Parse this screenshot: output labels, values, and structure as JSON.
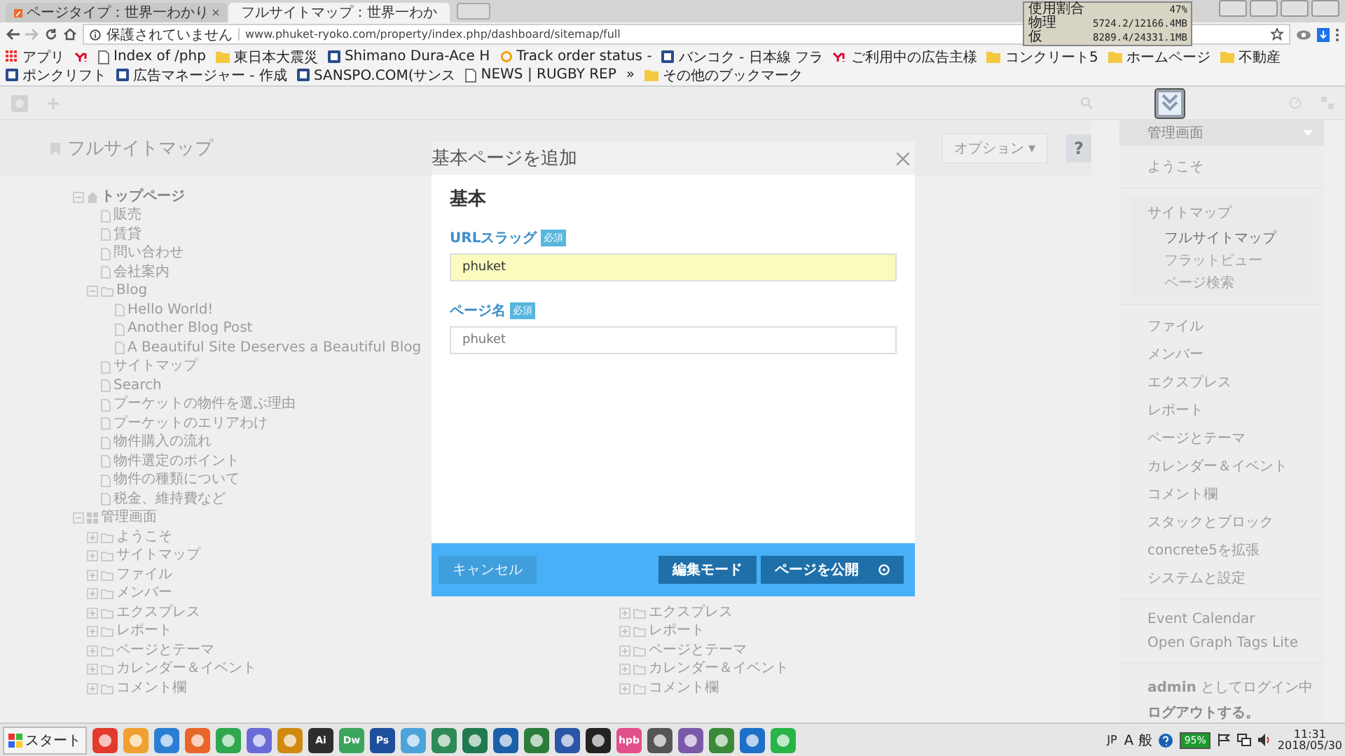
{
  "browser": {
    "tabs": [
      {
        "title": "ページタイプ：世界一わかり",
        "selected": false
      },
      {
        "title": "フルサイトマップ：世界一わか",
        "selected": true
      }
    ],
    "security": "保護されていません",
    "url": "www.phuket-ryoko.com/property/index.php/dashboard/sitemap/full",
    "bookmarks": [
      {
        "kind": "apps",
        "label": "アプリ"
      },
      {
        "kind": "yahoo"
      },
      {
        "kind": "page",
        "label": "Index of /php"
      },
      {
        "kind": "folder",
        "label": "東日本大震災"
      },
      {
        "kind": "site",
        "label": "Shimano Dura-Ace H"
      },
      {
        "kind": "bulb",
        "label": "Track order status -"
      },
      {
        "kind": "site",
        "label": "バンコク - 日本線 フラ"
      },
      {
        "kind": "yahoo",
        "label": "ご利用中の広告主様"
      },
      {
        "kind": "folder",
        "label": "コンクリート5"
      },
      {
        "kind": "folder",
        "label": "ホームページ"
      },
      {
        "kind": "folder",
        "label": "不動産"
      },
      {
        "kind": "site",
        "label": "ポンクリフト"
      },
      {
        "kind": "site",
        "label": "広告マネージャー - 作成"
      },
      {
        "kind": "site",
        "label": "SANSPO.COM(サンス"
      },
      {
        "kind": "page",
        "label": "NEWS | RUGBY REP"
      },
      {
        "kind": "more",
        "label": "»"
      },
      {
        "kind": "folder",
        "label": "その他のブックマーク"
      }
    ]
  },
  "memory_meter": [
    {
      "label": "使用割合",
      "value": "47%"
    },
    {
      "label": "物理",
      "value": "5724.2/12166.4MB"
    },
    {
      "label": "仮",
      "value": "8289.4/24331.1MB"
    }
  ],
  "page": {
    "title": "フルサイトマップ",
    "options_button": "オプション ▾",
    "help_button": "?"
  },
  "tree": [
    {
      "label": "トップページ",
      "kind": "home",
      "expanded": true,
      "children": [
        {
          "label": "販売",
          "kind": "page"
        },
        {
          "label": "賃貸",
          "kind": "page"
        },
        {
          "label": "問い合わせ",
          "kind": "page"
        },
        {
          "label": "会社案内",
          "kind": "page"
        },
        {
          "label": "Blog",
          "kind": "folder",
          "expanded": true,
          "children": [
            {
              "label": "Hello World!",
              "kind": "page"
            },
            {
              "label": "Another Blog Post",
              "kind": "page"
            },
            {
              "label": "A Beautiful Site Deserves a Beautiful Blog",
              "kind": "page"
            }
          ]
        },
        {
          "label": "サイトマップ",
          "kind": "page"
        },
        {
          "label": "Search",
          "kind": "page"
        },
        {
          "label": "プーケットの物件を選ぶ理由",
          "kind": "page"
        },
        {
          "label": "プーケットのエリアわけ",
          "kind": "page"
        },
        {
          "label": "物件購入の流れ",
          "kind": "page"
        },
        {
          "label": "物件選定のポイント",
          "kind": "page"
        },
        {
          "label": "物件の種類について",
          "kind": "page"
        },
        {
          "label": "税金、維持費など",
          "kind": "page"
        }
      ]
    },
    {
      "label": "管理画面",
      "kind": "dashboard",
      "expanded": true,
      "children": [
        {
          "label": "ようこそ",
          "kind": "folder",
          "expanded": false
        },
        {
          "label": "サイトマップ",
          "kind": "folder",
          "expanded": false
        },
        {
          "label": "ファイル",
          "kind": "folder",
          "expanded": false
        },
        {
          "label": "メンバー",
          "kind": "folder",
          "expanded": false
        },
        {
          "label": "エクスプレス",
          "kind": "folder",
          "expanded": false
        },
        {
          "label": "レポート",
          "kind": "folder",
          "expanded": false
        },
        {
          "label": "ページとテーマ",
          "kind": "folder",
          "expanded": false
        },
        {
          "label": "カレンダー＆イベント",
          "kind": "folder",
          "expanded": false
        },
        {
          "label": "コメント欄",
          "kind": "folder",
          "expanded": false
        }
      ]
    }
  ],
  "tree_column_2": [
    {
      "label": "エクスプレス",
      "kind": "folder",
      "expanded": false
    },
    {
      "label": "レポート",
      "kind": "folder",
      "expanded": false
    },
    {
      "label": "ページとテーマ",
      "kind": "folder",
      "expanded": false
    },
    {
      "label": "カレンダー＆イベント",
      "kind": "folder",
      "expanded": false
    },
    {
      "label": "コメント欄",
      "kind": "folder",
      "expanded": false
    }
  ],
  "panel": {
    "title": "管理画面",
    "sections": [
      {
        "items": [
          {
            "label": "ようこそ"
          }
        ]
      },
      {
        "items": [
          {
            "label": "サイトマップ",
            "children": [
              {
                "label": "フルサイトマップ",
                "selected": true
              },
              {
                "label": "フラットビュー",
                "selected": false
              },
              {
                "label": "ページ検索",
                "selected": false
              }
            ]
          }
        ]
      },
      {
        "items": [
          {
            "label": "ファイル"
          },
          {
            "label": "メンバー"
          },
          {
            "label": "エクスプレス"
          },
          {
            "label": "レポート"
          },
          {
            "label": "ページとテーマ"
          },
          {
            "label": "カレンダー＆イベント"
          },
          {
            "label": "コメント欄"
          },
          {
            "label": "スタックとブロック"
          },
          {
            "label": "concrete5を拡張"
          },
          {
            "label": "システムと設定"
          }
        ]
      },
      {
        "items": [
          {
            "label": "Event Calendar"
          },
          {
            "label": "Open Graph Tags Lite"
          }
        ]
      }
    ],
    "login": "**admin** としてログイン中",
    "logout": "ログアウトする。"
  },
  "dialog": {
    "title": "基本ページを追加",
    "section": "基本",
    "fields": [
      {
        "label": "URLスラッグ",
        "badge": "必須",
        "value": "phuket",
        "highlighted": true
      },
      {
        "label": "ページ名",
        "badge": "必須",
        "placeholder": "phuket",
        "highlighted": false
      }
    ],
    "buttons": [
      {
        "label": "キャンセル",
        "kind": "cancel"
      },
      {
        "label": "編集モード",
        "kind": "secondary"
      },
      {
        "label": "ページを公開",
        "kind": "primary"
      }
    ]
  },
  "taskbar": {
    "start": "スタート",
    "apps": [
      {
        "kind": "plain"
      },
      {
        "kind": "plain"
      },
      {
        "kind": "plain"
      },
      {
        "kind": "plain"
      },
      {
        "kind": "plain"
      },
      {
        "kind": "plain"
      },
      {
        "kind": "plain"
      },
      {
        "kind": "letter",
        "label": "Ai"
      },
      {
        "kind": "letter",
        "label": "Dw"
      },
      {
        "kind": "letter",
        "label": "Ps"
      },
      {
        "kind": "plain"
      },
      {
        "kind": "plain"
      },
      {
        "kind": "plain"
      },
      {
        "kind": "plain"
      },
      {
        "kind": "plain"
      },
      {
        "kind": "plain"
      },
      {
        "kind": "plain"
      },
      {
        "kind": "letter",
        "label": "hpb"
      },
      {
        "kind": "plain"
      },
      {
        "kind": "plain"
      },
      {
        "kind": "plain"
      },
      {
        "kind": "plain"
      },
      {
        "kind": "plain"
      }
    ],
    "language": "JP",
    "ime": "A 般",
    "battery": "95%",
    "time": "11:31",
    "date": "2018/05/30"
  }
}
